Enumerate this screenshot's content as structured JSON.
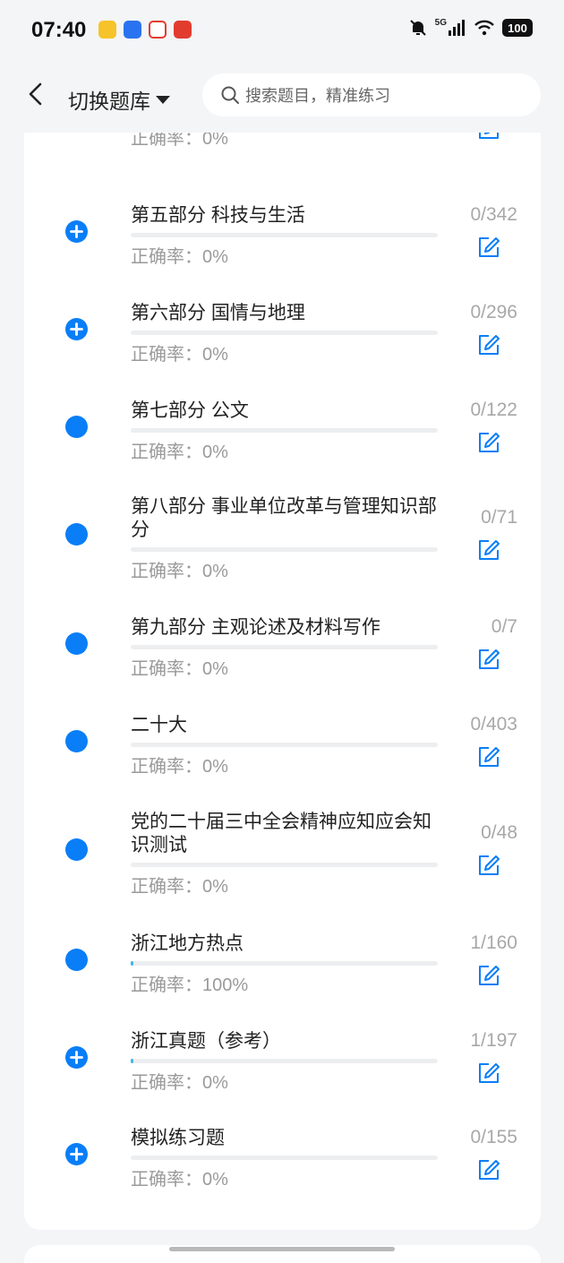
{
  "status_bar": {
    "time": "07:40",
    "app_icons": [
      {
        "name": "meituan-icon",
        "color": "#f6c32a"
      },
      {
        "name": "shield-app-icon",
        "color": "#2a73f0"
      },
      {
        "name": "red-triangle-app-icon",
        "color": "#e23c2e"
      },
      {
        "name": "red-seal-app-icon",
        "color": "#e23c2e"
      }
    ],
    "network_label": "5G",
    "battery": "100"
  },
  "header": {
    "bank_label": "切换题库",
    "search_placeholder": "搜索题目，精准练习"
  },
  "colors": {
    "accent": "#0a7ef7",
    "progress": "#42b6e8"
  },
  "list": [
    {
      "title": "",
      "accuracy": "正确率：0%",
      "count": "",
      "icon": "plus-circle-icon",
      "progress": 0
    },
    {
      "title": "第五部分 科技与生活",
      "accuracy": "正确率：0%",
      "count": "0/342",
      "icon": "plus-circle-icon",
      "progress": 0
    },
    {
      "title": "第六部分 国情与地理",
      "accuracy": "正确率：0%",
      "count": "0/296",
      "icon": "plus-circle-icon",
      "progress": 0
    },
    {
      "title": "第七部分 公文",
      "accuracy": "正确率：0%",
      "count": "0/122",
      "icon": "circle-icon",
      "progress": 0
    },
    {
      "title": "第八部分 事业单位改革与管理知识部分",
      "accuracy": "正确率：0%",
      "count": "0/71",
      "icon": "circle-icon",
      "progress": 0
    },
    {
      "title": "第九部分 主观论述及材料写作",
      "accuracy": "正确率：0%",
      "count": "0/7",
      "icon": "circle-icon",
      "progress": 0
    },
    {
      "title": "二十大",
      "accuracy": "正确率：0%",
      "count": "0/403",
      "icon": "circle-icon",
      "progress": 0
    },
    {
      "title": "党的二十届三中全会精神应知应会知识测试",
      "accuracy": "正确率：0%",
      "count": "0/48",
      "icon": "circle-icon",
      "progress": 0
    },
    {
      "title": "浙江地方热点",
      "accuracy": "正确率：100%",
      "count": "1/160",
      "icon": "circle-icon",
      "progress": 0.00625
    },
    {
      "title": "浙江真题（参考）",
      "accuracy": "正确率：0%",
      "count": "1/197",
      "icon": "plus-circle-icon",
      "progress": 0.005
    },
    {
      "title": "模拟练习题",
      "accuracy": "正确率：0%",
      "count": "0/155",
      "icon": "plus-circle-icon",
      "progress": 0
    }
  ]
}
